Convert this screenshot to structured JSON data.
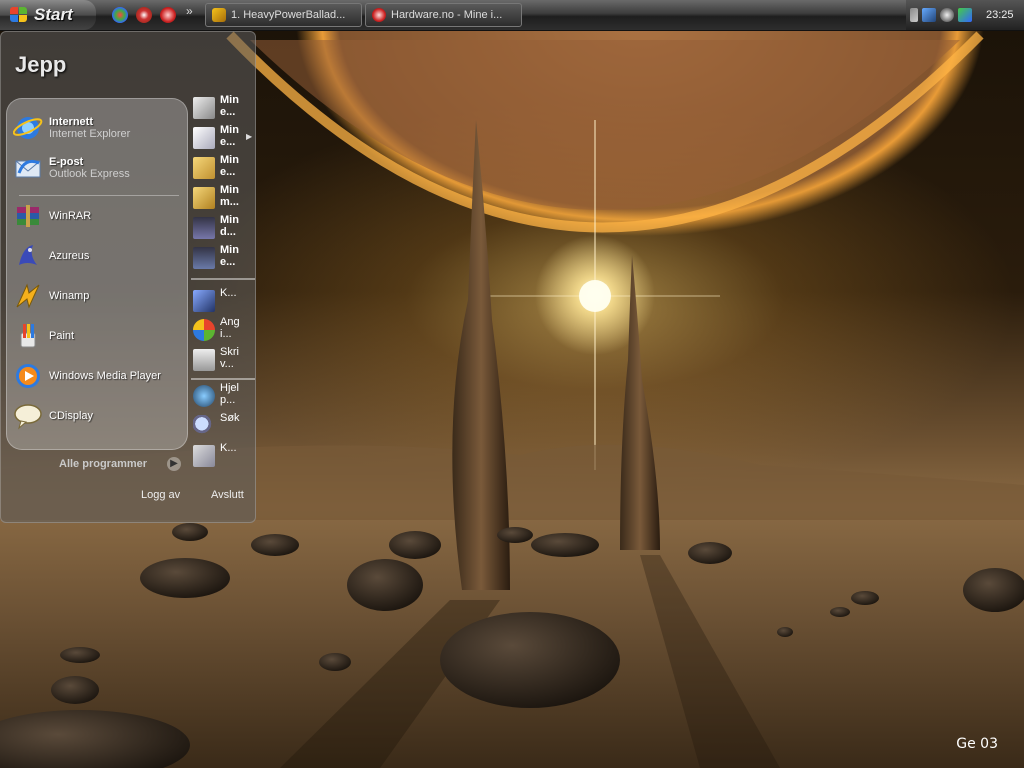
{
  "taskbar": {
    "start_label": "Start",
    "chevron": "»",
    "tasks": [
      {
        "label": "1. HeavyPowerBallad...",
        "icon": "winamp-icon"
      },
      {
        "label": "Hardware.no - Mine i...",
        "icon": "browser-icon"
      }
    ],
    "clock": "23:25"
  },
  "start_menu": {
    "user_name": "Jepp",
    "pinned": [
      {
        "name": "Internett",
        "sub": "Internet Explorer",
        "icon": "internet-explorer-icon"
      },
      {
        "name": "E-post",
        "sub": "Outlook Express",
        "icon": "outlook-express-icon"
      }
    ],
    "recent": [
      {
        "name": "WinRAR",
        "icon": "winrar-icon"
      },
      {
        "name": "Azureus",
        "icon": "azureus-icon"
      },
      {
        "name": "Winamp",
        "icon": "winamp-icon"
      },
      {
        "name": "Paint",
        "icon": "paint-icon"
      },
      {
        "name": "Windows Media Player",
        "icon": "media-player-icon"
      },
      {
        "name": "CDisplay",
        "icon": "cdisplay-icon"
      }
    ],
    "all_programs": "Alle programmer",
    "log_off": "Logg av",
    "shut_down": "Avslutt",
    "places": [
      {
        "label": "Min e...",
        "icon": "my-documents-icon"
      },
      {
        "label": "Min e...",
        "icon": "my-recent-documents-icon"
      },
      {
        "label": "Min e...",
        "icon": "my-pictures-icon"
      },
      {
        "label": "Min m...",
        "icon": "my-music-icon"
      },
      {
        "label": "Min d...",
        "icon": "my-computer-icon"
      },
      {
        "label": "Min e...",
        "icon": "my-network-icon"
      }
    ],
    "system": [
      {
        "label": "K...",
        "icon": "control-panel-icon"
      },
      {
        "label": "Ang i...",
        "icon": "default-programs-icon"
      },
      {
        "label": "Skri v...",
        "icon": "printers-icon"
      }
    ],
    "help": [
      {
        "label": "Hjel p...",
        "icon": "help-icon"
      },
      {
        "label": "Søk",
        "icon": "search-icon"
      },
      {
        "label": "K...",
        "icon": "run-icon"
      }
    ]
  },
  "desktop": {
    "corner_label": "Ge 03"
  }
}
